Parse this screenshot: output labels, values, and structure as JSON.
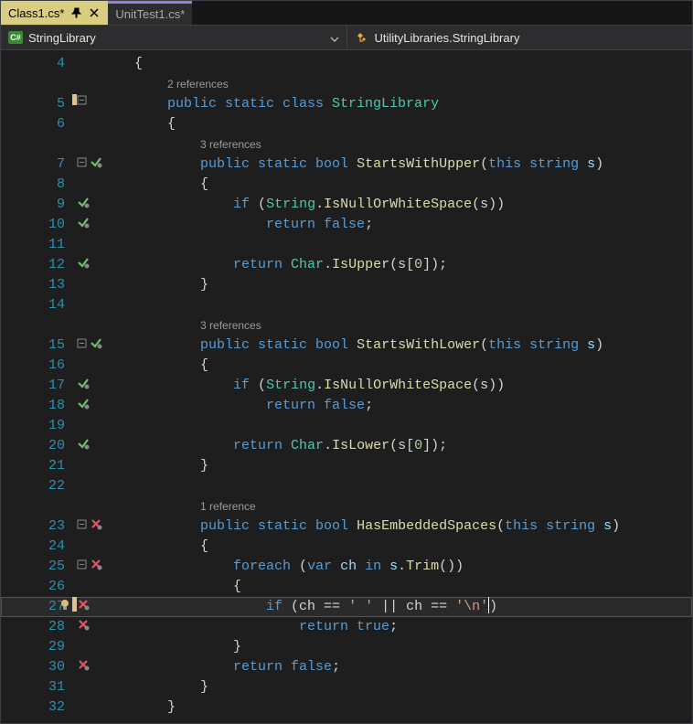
{
  "tabs": [
    {
      "label": "Class1.cs*",
      "active": true,
      "pinned": true,
      "closable": true
    },
    {
      "label": "UnitTest1.cs*",
      "active": false
    }
  ],
  "nav": {
    "left": {
      "iconText": "C#",
      "label": "StringLibrary"
    },
    "right": {
      "label": "UtilityLibraries.StringLibrary"
    }
  },
  "refs": {
    "class": "2 references",
    "m1": "3 references",
    "m2": "3 references",
    "m3": "1 reference"
  },
  "code": {
    "l4": "{",
    "l5_pre": "public static class ",
    "l5_class": "StringLibrary",
    "l6": "{",
    "l7_sig_pre": "public static ",
    "l7_ret": "bool",
    "l7_name": " StartsWithUpper",
    "l7_params_open": "(",
    "l7_this": "this ",
    "l7_ptype": "string",
    "l7_pname": " s",
    "l7_params_close": ")",
    "l8": "{",
    "l9_if": "if ",
    "l9_open": "(",
    "l9_type": "String",
    "l9_dot": ".",
    "l9_method": "IsNullOrWhiteSpace",
    "l9_arg": "(s))",
    "l10_ret": "return ",
    "l10_val": "false",
    "l10_semi": ";",
    "l12_ret": "return ",
    "l12_type": "Char",
    "l12_dot": ".",
    "l12_method": "IsUpper",
    "l12_open": "(s[",
    "l12_idx": "0",
    "l12_close": "]);",
    "l13": "}",
    "l15_name": " StartsWithLower",
    "l20_method": "IsLower",
    "l23_name": " HasEmbeddedSpaces",
    "l25_foreach": "foreach ",
    "l25_open": "(",
    "l25_var": "var",
    "l25_ch": " ch ",
    "l25_in": "in ",
    "l25_s": "s",
    "l25_dot": ".",
    "l25_trim": "Trim",
    "l25_close": "())",
    "l26": "{",
    "l27_if": "if ",
    "l27_open": "(ch == ",
    "l27_str1": "' '",
    "l27_or": " || ch == ",
    "l27_str2": "'\\n'",
    "l27_close": ")",
    "l28_ret": "return ",
    "l28_val": "true",
    "l28_semi": ";",
    "l29": "}",
    "l30_ret": "return ",
    "l30_val": "false",
    "l30_semi": ";",
    "l31": "}",
    "l32": "}"
  },
  "linenums": [
    "4",
    "5",
    "6",
    "7",
    "8",
    "9",
    "10",
    "11",
    "12",
    "13",
    "14",
    "15",
    "16",
    "17",
    "18",
    "19",
    "20",
    "21",
    "22",
    "23",
    "24",
    "25",
    "26",
    "27",
    "28",
    "29",
    "30",
    "31",
    "32"
  ]
}
